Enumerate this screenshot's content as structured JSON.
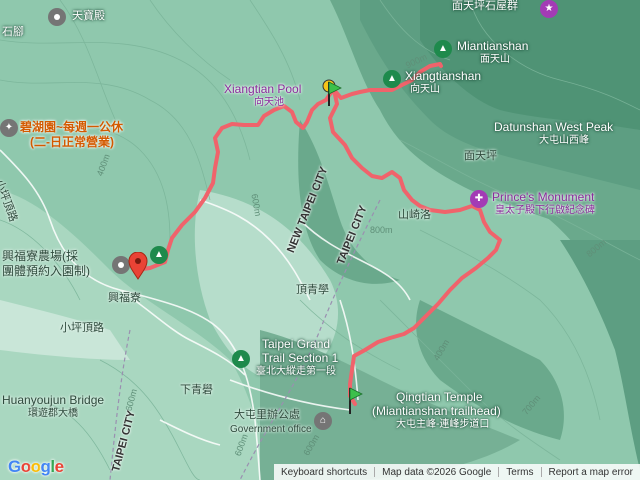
{
  "map": {
    "places": {
      "tianbaodian": "天寶殿",
      "shijiao": "石腳",
      "mianwu": "面天坪石屋群",
      "miantianshan_en": "Miantianshan",
      "miantianshan_zh": "面天山",
      "xiangtianshan_en": "Xiangtianshan",
      "xiangtianshan_zh": "向天山",
      "xiangtian_pool_en": "Xiangtian Pool",
      "xiangtian_pool_zh": "向天池",
      "datunshan_west_en": "Datunshan West Peak",
      "datunshan_west_zh": "大屯山西峰",
      "biyu_line1": "碧湖園~每週一公休",
      "biyu_line2": "(二-日正常營業)",
      "xiaopingding_road": "小坪頂路",
      "miantianping": "面天坪",
      "prince_en": "Prince's Monument",
      "prince_zh": "皇太子殿下行啟紀念碑",
      "xingfuliao_farm_1": "興福寮農場(採",
      "xingfuliao_farm_2": "團體預約入園制)",
      "xingfuliao": "興福寮",
      "new_taipei_city": "NEW TAIPEI CITY",
      "taipei_city": "TAIPEI CITY",
      "shanqi": "山崎洛",
      "dingqingxue": "頂青學",
      "xiaopingding": "小坪頂路",
      "trail_en_1": "Taipei Grand",
      "trail_en_2": "Trail Section 1",
      "trail_zh": "臺北大縱走第一段",
      "xiaqingxue": "下青礐",
      "huanyoujun_en": "Huanyoujun Bridge",
      "huanyoujun_zh": "環遊郡大橋",
      "datun_office_zh": "大屯里辦公處",
      "govt_office": "Government office",
      "qingtian_en_1": "Qingtian Temple",
      "qingtian_en_2": "(Miantianshan trailhead)",
      "qingtian_zh": "大屯主峰-連峰步道口",
      "taipei_city_2": "TAIPEI CITY"
    },
    "contours": [
      "400m",
      "600m",
      "800m",
      "900m",
      "400m",
      "600m",
      "800m",
      "700m",
      "600m",
      "600m"
    ],
    "logo": {
      "g1": "G",
      "o1": "o",
      "o2": "o",
      "g2": "g",
      "l": "l",
      "e": "e"
    },
    "attribution": {
      "shortcuts": "Keyboard shortcuts",
      "mapdata": "Map data ©2026 Google",
      "terms": "Terms",
      "report": "Report a map error"
    },
    "colors": {
      "terrain": "#8fc8ad",
      "route": "#f0636b",
      "poi_green": "#1e8a4c",
      "poi_purple": "#a33bb5"
    }
  }
}
